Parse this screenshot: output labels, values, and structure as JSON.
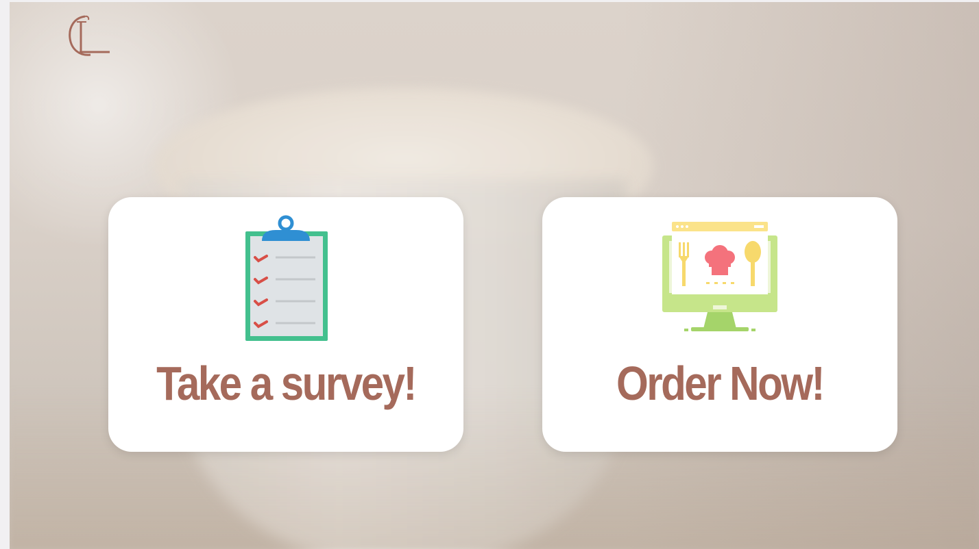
{
  "header": {
    "logo_icon": "cl-monogram-logo"
  },
  "cards": [
    {
      "label": "Take a survey!",
      "icon": "clipboard-checklist-icon"
    },
    {
      "label": "Order Now!",
      "icon": "online-food-order-monitor-icon"
    }
  ],
  "colors": {
    "label_text": "#a56a5b",
    "card_bg": "#ffffff",
    "logo": "#a56a5b"
  }
}
